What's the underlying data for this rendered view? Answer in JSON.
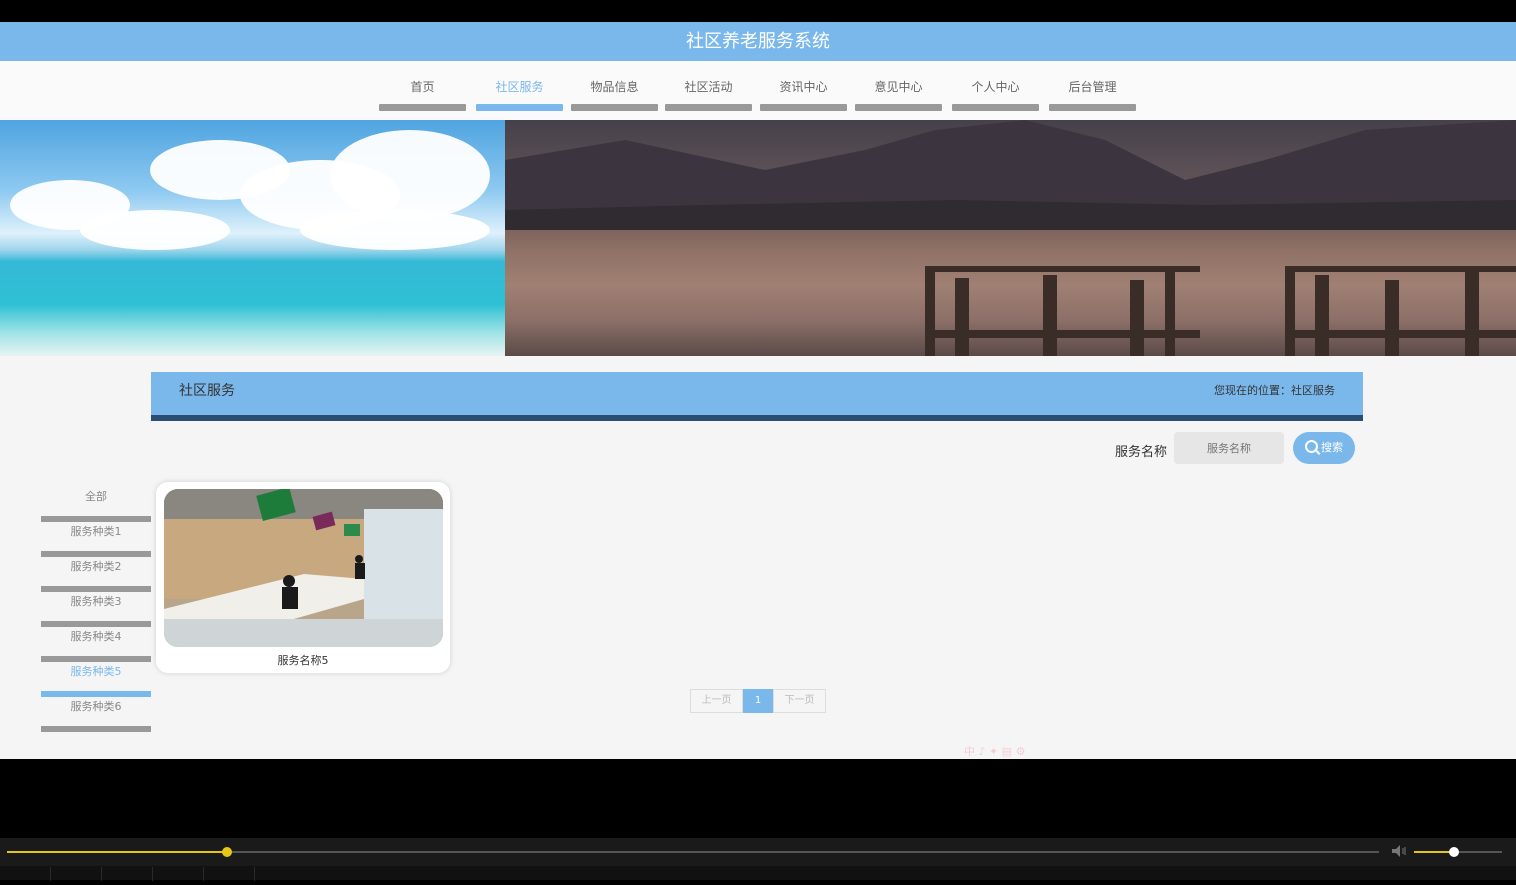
{
  "app": {
    "title": "社区养老服务系统"
  },
  "nav": {
    "items": [
      {
        "label": "首页"
      },
      {
        "label": "社区服务",
        "active": true
      },
      {
        "label": "物品信息"
      },
      {
        "label": "社区活动"
      },
      {
        "label": "资讯中心"
      },
      {
        "label": "意见中心"
      },
      {
        "label": "个人中心"
      },
      {
        "label": "后台管理"
      }
    ]
  },
  "section": {
    "title": "社区服务",
    "location": "您现在的位置：社区服务"
  },
  "search": {
    "label": "服务名称",
    "placeholder": "服务名称",
    "button": "搜索",
    "button_icon": "search-icon"
  },
  "categories": [
    {
      "label": "全部"
    },
    {
      "label": "服务种类1"
    },
    {
      "label": "服务种类2"
    },
    {
      "label": "服务种类3"
    },
    {
      "label": "服务种类4"
    },
    {
      "label": "服务种类5",
      "active": true
    },
    {
      "label": "服务种类6"
    }
  ],
  "items": [
    {
      "name": "服务名称5"
    }
  ],
  "pagination": {
    "prev": "上一页",
    "current": "1",
    "next": "下一页"
  },
  "ime": {
    "text": "中 ♪ ✦ ▤ ⚙"
  },
  "player": {
    "progress": 0.16,
    "volume": 0.45
  },
  "colors": {
    "accent": "#7ab8ec",
    "dark_accent": "#2b4d73",
    "player_accent": "#e6c619"
  }
}
